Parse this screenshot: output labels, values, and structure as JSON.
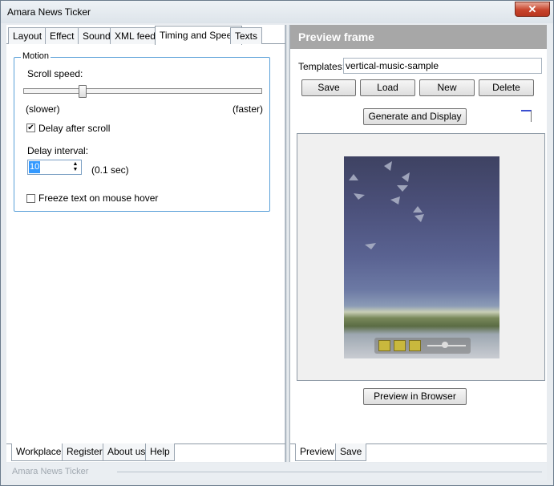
{
  "window": {
    "title": "Amara News Ticker",
    "close_label": "✕"
  },
  "top_tabs": [
    {
      "label": "Layout"
    },
    {
      "label": "Effect"
    },
    {
      "label": "Sound"
    },
    {
      "label": "XML feed"
    },
    {
      "label": "Timing and Speed",
      "active": true
    },
    {
      "label": "Texts"
    }
  ],
  "motion": {
    "group_title": "Motion",
    "scroll_speed_label": "Scroll speed:",
    "slider_min_label": "(slower)",
    "slider_max_label": "(faster)",
    "slider_value_fraction": 0.24,
    "delay_after_scroll_label": "Delay after scroll",
    "delay_after_scroll_checked": true,
    "delay_interval_label": "Delay interval:",
    "delay_interval_value": "10",
    "delay_unit": "(0.1 sec)",
    "freeze_label": "Freeze text on mouse hover",
    "freeze_checked": false
  },
  "bottom_tabs_left": [
    {
      "label": "Workplace",
      "active": true
    },
    {
      "label": "Register"
    },
    {
      "label": "About us"
    },
    {
      "label": "Help"
    }
  ],
  "preview": {
    "header": "Preview frame",
    "templates_label": "Templates:",
    "template_value": "vertical-music-sample",
    "buttons": {
      "save": "Save",
      "load": "Load",
      "new": "New",
      "delete": "Delete"
    },
    "generate_label": "Generate and Display",
    "preview_browser_label": "Preview in Browser"
  },
  "bottom_tabs_right": [
    {
      "label": "Preview",
      "active": true
    },
    {
      "label": "Save"
    }
  ],
  "status": {
    "text": "Amara News Ticker"
  },
  "colors": {
    "accent": "#5aa0d8",
    "preview_header_bg": "#a7a7a7",
    "selection": "#3399ff"
  }
}
